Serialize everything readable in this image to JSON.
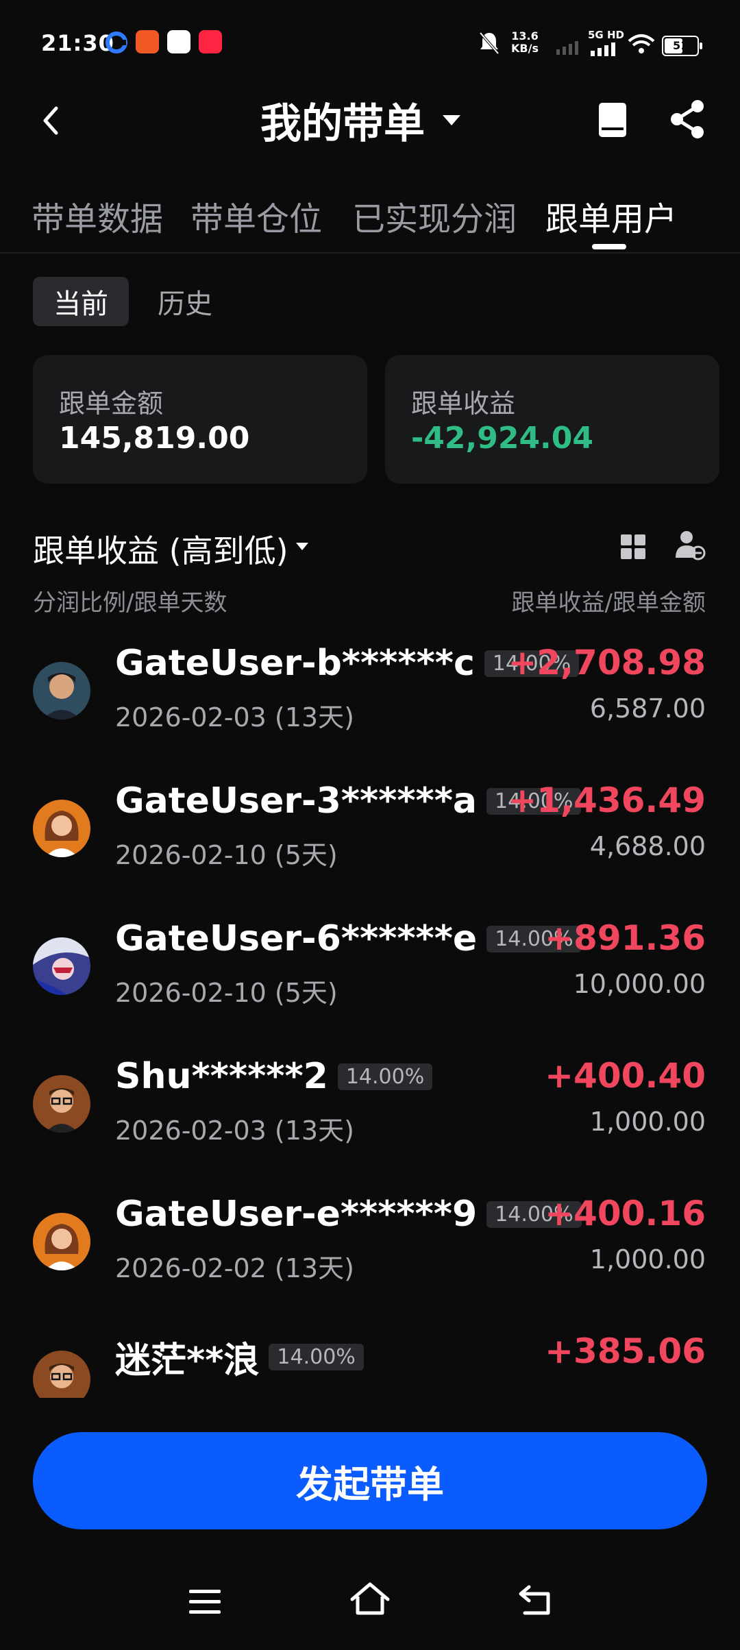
{
  "status_bar": {
    "time": "21:30",
    "network_speed_value": "13.6",
    "network_speed_unit": "KB/s",
    "network_label": "5G HD",
    "battery": "51"
  },
  "header": {
    "title": "我的带单"
  },
  "tabs": [
    {
      "label": "带单数据",
      "active": false
    },
    {
      "label": "带单仓位",
      "active": false
    },
    {
      "label": "已实现分润",
      "active": false
    },
    {
      "label": "跟单用户",
      "active": true
    }
  ],
  "segments": {
    "current": "当前",
    "history": "历史"
  },
  "summary": {
    "amount_label": "跟单金额",
    "amount_value": "145,819.00",
    "profit_label": "跟单收益",
    "profit_value": "-42,924.04",
    "profit_color": "#2fbd85"
  },
  "sort": {
    "label": "跟单收益 (高到低)",
    "col_left": "分润比例/跟单天数",
    "col_right": "跟单收益/跟单金额"
  },
  "followers": [
    {
      "name": "GateUser-b******c",
      "pct": "14.00%",
      "date": "2026-02-03 (13天)",
      "profit": "+2,708.98",
      "amount": "6,587.00",
      "avatar": "man-blue"
    },
    {
      "name": "GateUser-3******a",
      "pct": "14.00%",
      "date": "2026-02-10 (5天)",
      "profit": "+1,436.49",
      "amount": "4,688.00",
      "avatar": "woman-orange"
    },
    {
      "name": "GateUser-6******e",
      "pct": "14.00%",
      "date": "2026-02-10 (5天)",
      "profit": "+891.36",
      "amount": "10,000.00",
      "avatar": "anime"
    },
    {
      "name": "Shu******2",
      "pct": "14.00%",
      "date": "2026-02-03 (13天)",
      "profit": "+400.40",
      "amount": "1,000.00",
      "avatar": "man-glasses"
    },
    {
      "name": "GateUser-e******9",
      "pct": "14.00%",
      "date": "2026-02-02 (13天)",
      "profit": "+400.16",
      "amount": "1,000.00",
      "avatar": "woman-orange"
    },
    {
      "name": "迷茫**浪",
      "pct": "14.00%",
      "date": "",
      "profit": "+385.06",
      "amount": "",
      "avatar": "man-glasses"
    }
  ],
  "cta": {
    "label": "发起带单",
    "color": "#0a5cff"
  },
  "colors": {
    "profit_positive": "#f0475e",
    "background": "#0b0b0c"
  }
}
